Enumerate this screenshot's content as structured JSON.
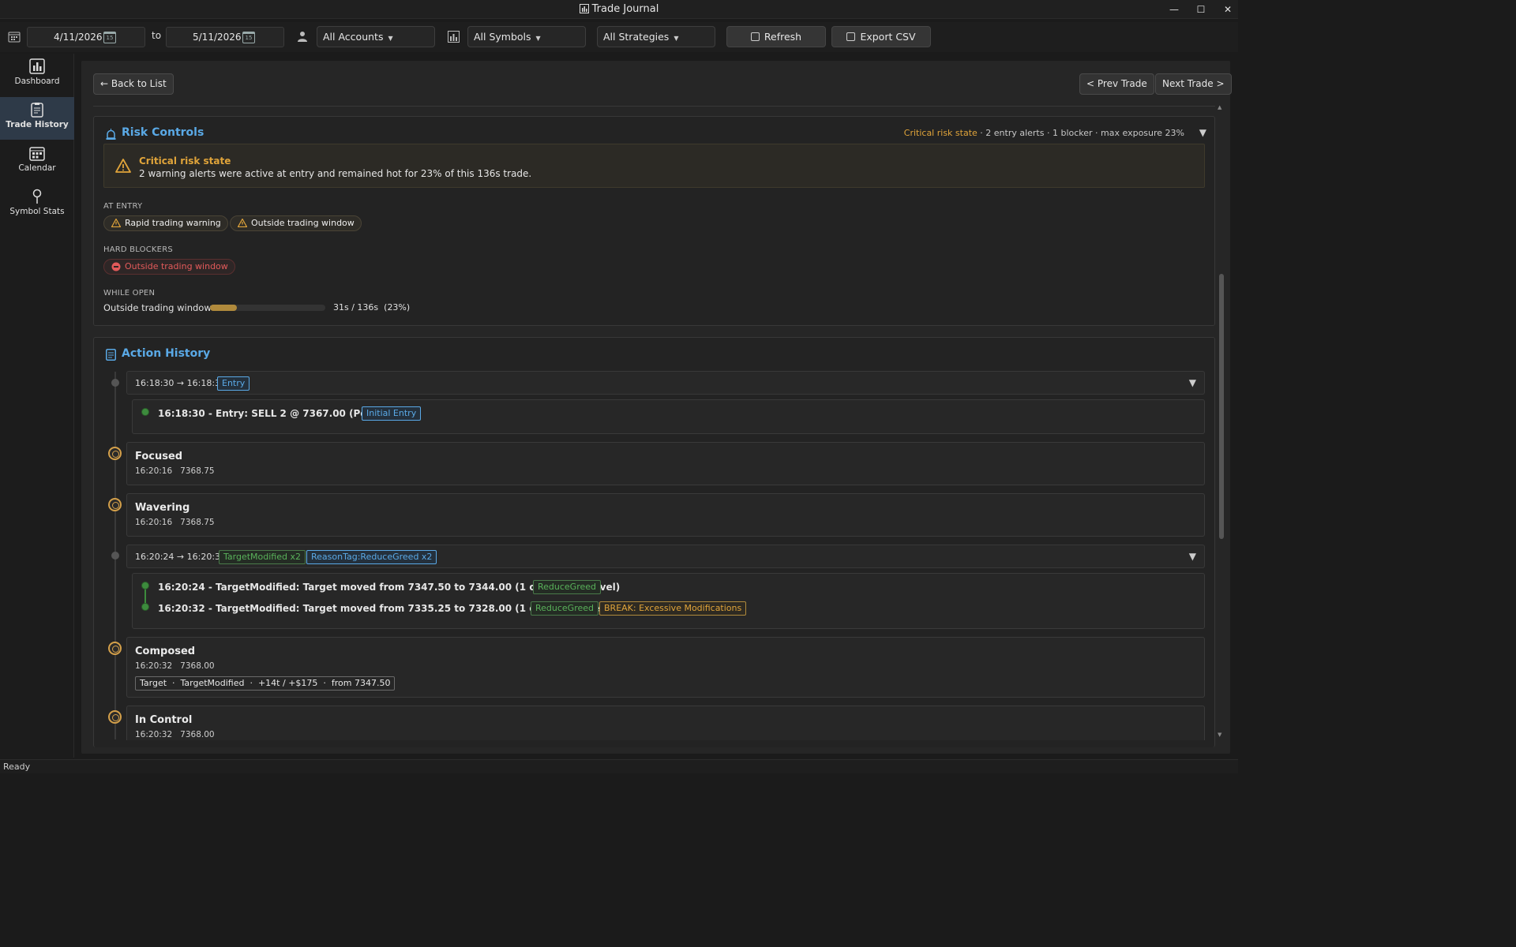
{
  "window": {
    "title": "Trade Journal",
    "minimize": "—",
    "maximize": "☐",
    "close": "✕"
  },
  "toolbar": {
    "date_from": "4/11/2026",
    "date_to": "5/11/2026",
    "to_label": "to",
    "calendar_glyph": "15",
    "accounts": "All Accounts",
    "symbols": "All Symbols",
    "strategies": "All Strategies",
    "refresh": "Refresh",
    "export": "Export CSV"
  },
  "sidebar": {
    "items": [
      {
        "label": "Dashboard"
      },
      {
        "label": "Trade History"
      },
      {
        "label": "Calendar"
      },
      {
        "label": "Symbol Stats"
      }
    ]
  },
  "nav": {
    "back": "← Back to List",
    "prev": "< Prev Trade",
    "next": "Next Trade >"
  },
  "risk": {
    "title": "Risk Controls",
    "summary_state": "Critical risk state",
    "summary_rest": " · 2 entry alerts · 1 blocker · max exposure 23%",
    "alert_title": "Critical risk state",
    "alert_text": "2 warning alerts were active at entry and remained hot for 23% of this 136s trade.",
    "at_entry_label": "AT ENTRY",
    "at_entry": [
      "Rapid trading warning",
      "Outside trading window"
    ],
    "hard_blockers_label": "HARD BLOCKERS",
    "hard_blockers": [
      "Outside trading window"
    ],
    "while_open_label": "WHILE OPEN",
    "while_open_name": "Outside trading window",
    "while_open_fraction": 0.23,
    "while_open_value": "31s / 136s  (23%)"
  },
  "history": {
    "title": "Action History",
    "group1": {
      "time": "16:18:30 → 16:18:30",
      "tag": "Entry",
      "event": "16:18:30 - Entry: SELL 2 @ 7367.00 (Position: 2)",
      "event_tag": "Initial Entry"
    },
    "mood1": {
      "name": "Focused",
      "meta": "16:20:16   7368.75"
    },
    "mood2": {
      "name": "Wavering",
      "meta": "16:20:16   7368.75"
    },
    "group2": {
      "time": "16:20:24 → 16:20:32",
      "tag1": "TargetModified x2",
      "tag2": "ReasonTag:ReduceGreed x2",
      "event1": "16:20:24 - TargetModified: Target moved from 7347.50 to 7344.00 (1 order(s) at level)",
      "event1_tag": "ReduceGreed",
      "event2": "16:20:32 - TargetModified: Target moved from 7335.25 to 7328.00 (1 order(s) at level)",
      "event2_tag": "ReduceGreed",
      "event2_tag2": "BREAK: Excessive Modifications"
    },
    "mood3": {
      "name": "Composed",
      "meta": "16:20:32   7368.00",
      "detail": "Target  ·  TargetModified  ·  +14t / +$175  ·  from 7347.50"
    },
    "mood4": {
      "name": "In Control",
      "meta": "16:20:32   7368.00"
    }
  },
  "status": "Ready",
  "colors": {
    "accent": "#5aa9e6",
    "warning": "#e0a43a",
    "danger": "#e25a5a",
    "success": "#59b15a"
  }
}
